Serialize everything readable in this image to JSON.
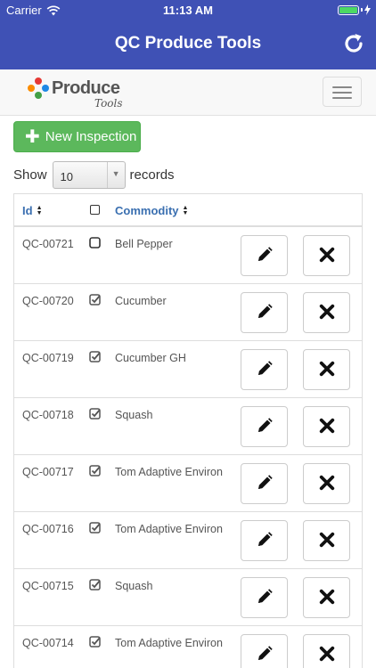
{
  "status_bar": {
    "carrier": "Carrier",
    "time": "11:13 AM"
  },
  "nav": {
    "title": "QC Produce Tools",
    "refresh_icon": "refresh-icon"
  },
  "logo": {
    "word": "Produce",
    "sub": "Tools"
  },
  "actions": {
    "new_inspection": "New Inspection"
  },
  "records": {
    "show": "Show",
    "page_size": "10",
    "suffix": "records"
  },
  "table": {
    "headers": {
      "id": "Id",
      "commodity": "Commodity"
    },
    "rows": [
      {
        "id": "QC-00721",
        "checked": false,
        "commodity": "Bell Pepper"
      },
      {
        "id": "QC-00720",
        "checked": true,
        "commodity": "Cucumber"
      },
      {
        "id": "QC-00719",
        "checked": true,
        "commodity": "Cucumber GH"
      },
      {
        "id": "QC-00718",
        "checked": true,
        "commodity": "Squash"
      },
      {
        "id": "QC-00717",
        "checked": true,
        "commodity": "Tom Adaptive Environ"
      },
      {
        "id": "QC-00716",
        "checked": true,
        "commodity": "Tom Adaptive Environ"
      },
      {
        "id": "QC-00715",
        "checked": true,
        "commodity": "Squash"
      },
      {
        "id": "QC-00714",
        "checked": true,
        "commodity": "Tom Adaptive Environ"
      }
    ]
  },
  "colors": {
    "nav_bg": "#3f51b5",
    "success": "#5cb85c",
    "link": "#3a6fb0"
  }
}
